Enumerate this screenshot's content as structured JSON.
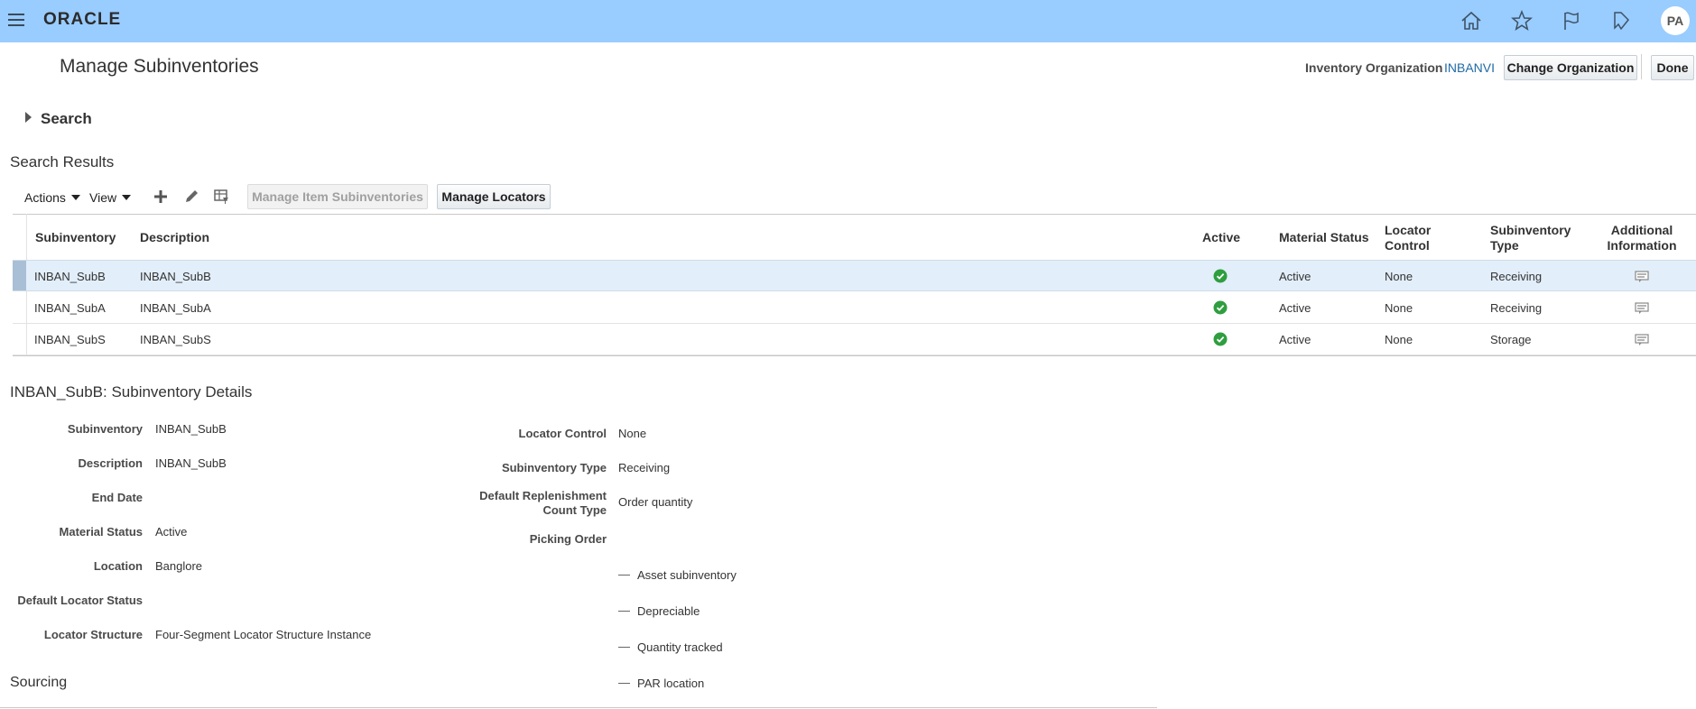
{
  "header": {
    "logo": "ORACLE",
    "user_initials": "PA",
    "icons": [
      "home-icon",
      "star-icon",
      "flag-icon",
      "notifications-icon"
    ]
  },
  "page": {
    "title": "Manage Subinventories",
    "org_label": "Inventory Organization",
    "org_value": "INBANVI",
    "change_org_button": "Change Organization",
    "done_button": "Done"
  },
  "search": {
    "label": "Search"
  },
  "results": {
    "title": "Search Results",
    "actions_label": "Actions",
    "view_label": "View",
    "manage_item_subinventories": "Manage Item Subinventories",
    "manage_locators": "Manage Locators",
    "columns": {
      "subinventory": "Subinventory",
      "description": "Description",
      "active": "Active",
      "material_status": "Material Status",
      "locator_control_1": "Locator",
      "locator_control_2": "Control",
      "subinventory_type_1": "Subinventory",
      "subinventory_type_2": "Type",
      "additional_info_1": "Additional",
      "additional_info_2": "Information"
    },
    "rows": [
      {
        "subinventory": "INBAN_SubB",
        "description": "INBAN_SubB",
        "material_status": "Active",
        "locator_control": "None",
        "type": "Receiving"
      },
      {
        "subinventory": "INBAN_SubA",
        "description": "INBAN_SubA",
        "material_status": "Active",
        "locator_control": "None",
        "type": "Receiving"
      },
      {
        "subinventory": "INBAN_SubS",
        "description": "INBAN_SubS",
        "material_status": "Active",
        "locator_control": "None",
        "type": "Storage"
      }
    ]
  },
  "details": {
    "title": "INBAN_SubB: Subinventory Details",
    "left": {
      "subinventory_label": "Subinventory",
      "subinventory_value": "INBAN_SubB",
      "description_label": "Description",
      "description_value": "INBAN_SubB",
      "end_date_label": "End Date",
      "material_status_label": "Material Status",
      "material_status_value": "Active",
      "location_label": "Location",
      "location_value": "Banglore",
      "default_locator_status_label": "Default Locator Status",
      "locator_structure_label": "Locator Structure",
      "locator_structure_value": "Four-Segment Locator Structure Instance"
    },
    "right": {
      "locator_control_label": "Locator Control",
      "locator_control_value": "None",
      "subinventory_type_label": "Subinventory Type",
      "subinventory_type_value": "Receiving",
      "replenishment_label_1": "Default Replenishment",
      "replenishment_label_2": "Count Type",
      "replenishment_value": "Order quantity",
      "picking_order_label": "Picking Order",
      "checks": [
        "Asset subinventory",
        "Depreciable",
        "Quantity tracked",
        "PAR location"
      ]
    }
  },
  "sourcing": {
    "title": "Sourcing"
  }
}
